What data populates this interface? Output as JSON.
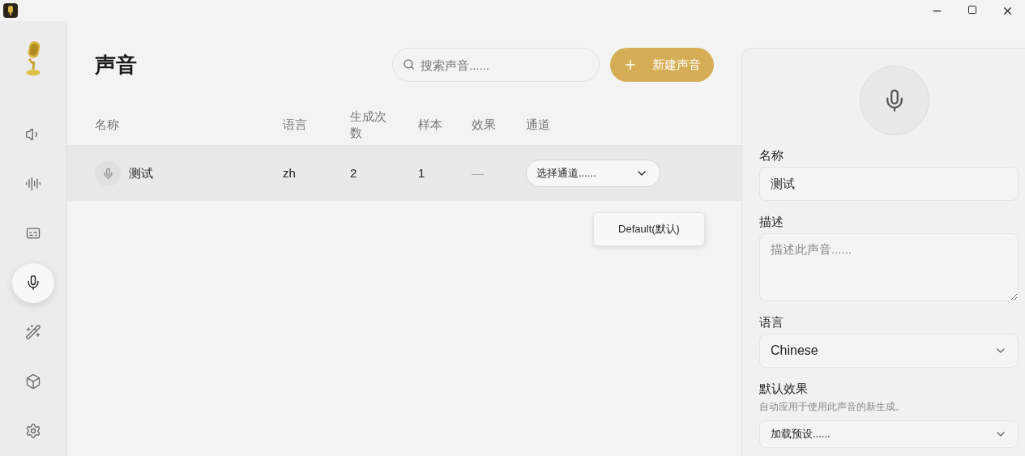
{
  "sidebar": {
    "items": [
      {
        "kind": "speaker",
        "selected": false
      },
      {
        "kind": "waveform",
        "selected": false
      },
      {
        "kind": "captions",
        "selected": false
      },
      {
        "kind": "mic",
        "selected": true
      },
      {
        "kind": "wand",
        "selected": false
      },
      {
        "kind": "box",
        "selected": false
      },
      {
        "kind": "settings",
        "selected": false
      }
    ]
  },
  "page": {
    "title": "声音",
    "search": {
      "placeholder": "搜索声音......"
    },
    "new_button": {
      "label": "新建声音"
    }
  },
  "table": {
    "columns": [
      "名称",
      "语言",
      "生成次数",
      "样本",
      "效果",
      "通道"
    ],
    "rows": [
      {
        "name": "测试",
        "language": "zh",
        "generations": "2",
        "samples": "1",
        "effects": "—",
        "channel": {
          "placeholder": "选择通道......",
          "expanded": true,
          "options": [
            {
              "label": "Default(默认)",
              "selected": false
            }
          ]
        }
      }
    ]
  },
  "editor": {
    "fields": [
      {
        "kind": "text",
        "label": "名称",
        "value": "测试"
      },
      {
        "kind": "textarea",
        "label": "描述",
        "placeholder": "描述此声音......"
      },
      {
        "kind": "select",
        "label": "语言",
        "value": "Chinese"
      },
      {
        "kind": "select",
        "label": "默认效果",
        "hint": "自动应用于使用此声音的新生成。",
        "value": "加载预设......"
      }
    ]
  }
}
